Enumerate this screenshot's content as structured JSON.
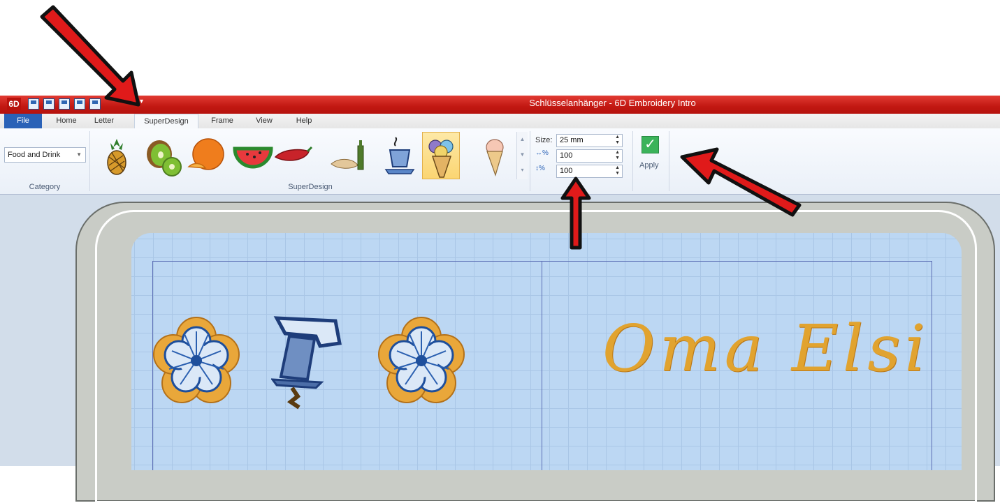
{
  "window": {
    "title": "Schlüsselanhänger - 6D Embroidery Intro",
    "logo": "6D",
    "quick_access_icons": [
      "open-icon",
      "save-icon",
      "save-as-icon",
      "save-all-icon",
      "print-icon"
    ],
    "quick_access_dropdown": "▾"
  },
  "tabs": [
    {
      "label": "File"
    },
    {
      "label": "Home"
    },
    {
      "label": "Letter"
    },
    {
      "label": "SuperDesign",
      "active": true
    },
    {
      "label": "Frame"
    },
    {
      "label": "View"
    },
    {
      "label": "Help"
    }
  ],
  "ribbon": {
    "category": {
      "value": "Food and Drink",
      "group_label": "Category"
    },
    "superdesign": {
      "group_label": "SuperDesign",
      "items": [
        {
          "icon": "pineapple-icon"
        },
        {
          "icon": "kiwi-icon"
        },
        {
          "icon": "orange-icon"
        },
        {
          "icon": "watermelon-icon"
        },
        {
          "icon": "chili-pepper-icon"
        },
        {
          "icon": "bread-and-wine-icon"
        },
        {
          "icon": "coffee-cup-icon"
        },
        {
          "icon": "ice-cream-cup-icon",
          "selected": true
        },
        {
          "icon": "ice-cream-cone-icon"
        }
      ]
    },
    "size": {
      "size_label": "Size:",
      "size_value": "25 mm",
      "width_percent": "100",
      "height_percent": "100",
      "width_icon": "↔%",
      "height_icon": "↕%"
    },
    "apply": {
      "label": "Apply",
      "icon": "checkmark-icon"
    }
  },
  "canvas": {
    "text": "Oma Elsi",
    "designs": [
      "flower-design",
      "coffee-cup-design",
      "flower-design"
    ]
  },
  "colors": {
    "title_bar": "#c21812",
    "file_tab": "#2a62b7",
    "fabric": "#bcd7f3",
    "thread_gold": "#e1a32f",
    "thread_blue": "#1e4f9c",
    "annotation_arrow": "#e01a1a"
  }
}
